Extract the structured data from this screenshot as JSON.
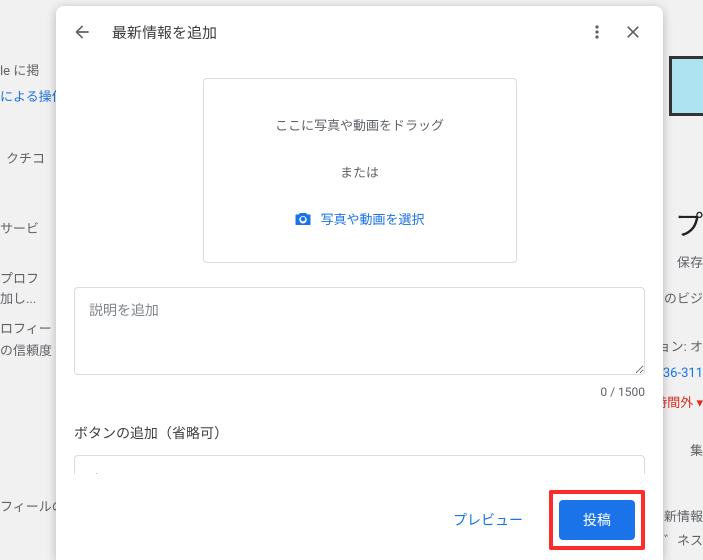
{
  "backdrop": {
    "l1": "le に掲",
    "l2": "による操作",
    "l3": "クチコ",
    "l4": "サービ",
    "l5": "プロフ",
    "l6": "加し...",
    "l7": "ロフィー",
    "l8": "の信頼度",
    "l9": "フィールの",
    "l10": "プ",
    "l11": "保存",
    "l12": "のビジ",
    "l13": "ョン: オ",
    "l14": "36-311",
    "l15": "時間外 ▾",
    "l16": "集",
    "l17": "新情報",
    "l18": "゛ネス"
  },
  "modal": {
    "title": "最新情報を追加",
    "dropzone": {
      "drag": "ここに写真や動画をドラッグ",
      "or": "または",
      "select": "写真や動画を選択"
    },
    "description": {
      "placeholder": "説明を追加",
      "value": "",
      "counter": "0 / 1500"
    },
    "button_section": {
      "label": "ボタンの追加（省略可）",
      "selected": "なし"
    },
    "footer": {
      "preview": "プレビュー",
      "post": "投稿"
    }
  }
}
